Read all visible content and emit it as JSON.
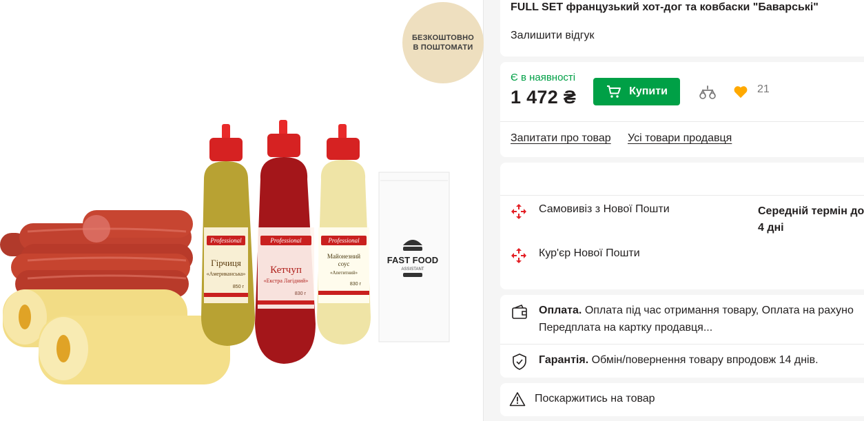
{
  "gallery": {
    "badge_line1": "БЕЗКОШТОВНО",
    "badge_line2": "В ПОШТОМАТИ",
    "image_labels": {
      "mustard_brand": "Professional",
      "mustard_name": "Гірчиця",
      "mustard_sub": "«Американська»",
      "mustard_weight": "850 г",
      "ketchup_brand": "Professional",
      "ketchup_name": "Кетчуп",
      "ketchup_sub": "«Екстра Лагідний»",
      "ketchup_weight": "830 г",
      "mayo_brand": "Professional",
      "mayo_name": "Майонезний соус",
      "mayo_sub": "«Апетитний»",
      "mayo_weight": "830 г",
      "bag_line1": "FAST FOOD",
      "bag_line2": "ASSISTANT"
    }
  },
  "product": {
    "title": "FULL SET французький хот-дог та ковбаски \"Баварські\"",
    "review_link": "Залишити відгук"
  },
  "buy": {
    "stock_status": "Є в наявності",
    "price": "1 472 ₴",
    "buy_label": "Купити",
    "favorites_count": "21",
    "ask_link": "Запитати про товар",
    "seller_link": "Усі товари продавця"
  },
  "delivery": {
    "options": [
      {
        "label": "Самовивіз з Нової Пошти",
        "icon": "nova-poshta-icon"
      },
      {
        "label": "Кур'єр Нової Пошти",
        "icon": "nova-poshta-icon"
      }
    ],
    "avg_term_label": "Середній термін до",
    "avg_term_value": "4 дні"
  },
  "payment": {
    "label": "Оплата.",
    "text_line1": "Оплата під час отримання товару, Оплата на рахуно",
    "text_line2": "Передплата на картку продавця..."
  },
  "warranty": {
    "label": "Гарантія.",
    "text": "Обмін/повернення товару впродовж 14 днів."
  },
  "complain": {
    "label": "Поскаржитись на товар"
  },
  "colors": {
    "accent_green": "#00a046",
    "favorite_orange": "#ffa900",
    "nova_poshta_red": "#e31e24",
    "badge_beige": "#eedfbf"
  }
}
